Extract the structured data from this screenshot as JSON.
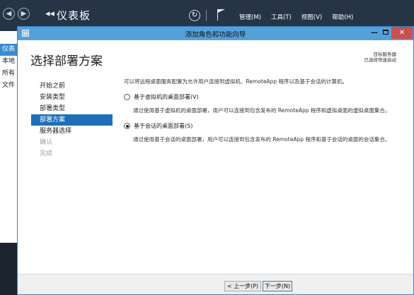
{
  "server_manager": {
    "title": "仪表板",
    "breadcrumb_arrows": "◂◂",
    "menu": [
      "管理(M)",
      "工具(T)",
      "视图(V)",
      "帮助(H)"
    ],
    "left_nav": [
      "仪表",
      "本地",
      "所有",
      "文件"
    ]
  },
  "wizard": {
    "title": "添加角色和功能向导",
    "heading": "选择部署方案",
    "destination_label": "目标服务器",
    "destination_value": "已选择快速启动",
    "steps": [
      {
        "label": "开始之前",
        "state": "normal"
      },
      {
        "label": "安装类型",
        "state": "normal"
      },
      {
        "label": "部署类型",
        "state": "normal"
      },
      {
        "label": "部署方案",
        "state": "active"
      },
      {
        "label": "服务器选择",
        "state": "normal"
      },
      {
        "label": "确认",
        "state": "disabled"
      },
      {
        "label": "完成",
        "state": "disabled"
      }
    ],
    "intro": "可以将远程桌面服务配置为允许用户连接到虚拟机、RemoteApp 程序以及基于会话的计算机。",
    "options": [
      {
        "label": "基于虚拟机的桌面部署(V)",
        "description": "通过使用基于虚拟机的桌面部署，用户可以连接到包含发布的 RemoteApp 程序和虚拟桌面的虚拟桌面集合。",
        "checked": false
      },
      {
        "label": "基于会话的桌面部署(S)",
        "description": "通过使用基于会话的桌面部署，用户可以连接到包含发布的 RemoteApp 程序和基于会话的桌面的会话集合。",
        "checked": true
      }
    ],
    "buttons": {
      "prev": "< 上一步(P)",
      "next": "下一步(N)"
    }
  },
  "icons": [
    "back-icon",
    "forward-icon",
    "refresh-icon",
    "flag-icon",
    "app-icon",
    "minimize-icon",
    "maximize-icon",
    "close-icon",
    "radio-icon"
  ],
  "colors": {
    "header_bg": "#263446",
    "titlebar_bg": "#56a0d8",
    "active_step": "#1f6fb8",
    "close_button": "#c75050"
  }
}
